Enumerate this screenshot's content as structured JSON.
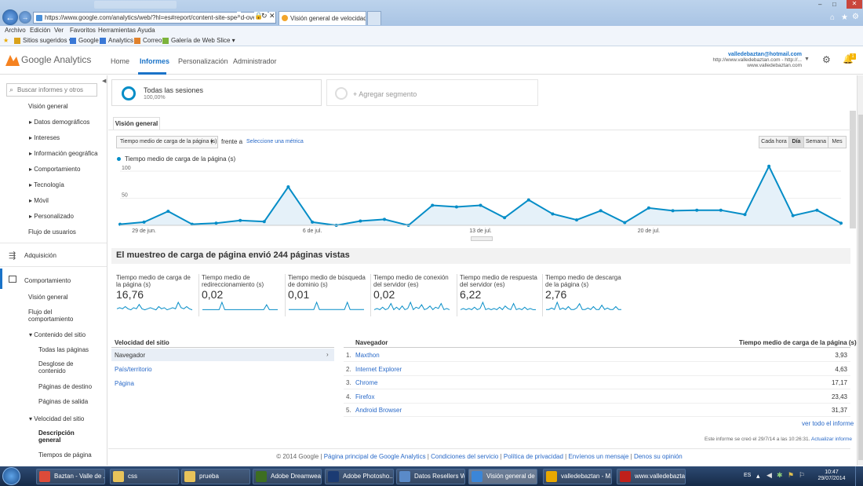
{
  "browser": {
    "url": "https://www.google.com/analytics/web/?hl=es#report/content-site-speed-overvi",
    "tabs": [
      {
        "label": "Visión general de velocidad..."
      }
    ],
    "blurred_tab": "",
    "window_controls": {
      "min": "–",
      "max": "□",
      "close": "✕"
    },
    "menu": [
      "Archivo",
      "Edición",
      "Ver",
      "Favoritos",
      "Herramientas",
      "Ayuda"
    ],
    "favorites": [
      "Sitios sugeridos ▾",
      "Google",
      "Analytics",
      "Correo",
      "Galería de Web Slice ▾"
    ]
  },
  "ga": {
    "logo": "Google Analytics",
    "tabs": [
      "Home",
      "Informes",
      "Personalización",
      "Administrador"
    ],
    "account_email": "valledebaztan@hotmail.com",
    "account_url": "http://www.valledebaztan.com - http://...",
    "account_site": "www.valledebaztan.com",
    "notif_count": "1"
  },
  "sidebar": {
    "search_placeholder": "Buscar informes y otros",
    "items": [
      "Visión general",
      "Datos demográficos",
      "Intereses",
      "Información geográfica",
      "Comportamiento",
      "Tecnología",
      "Móvil",
      "Personalizado",
      "Flujo de usuarios",
      "Adquisición",
      "Comportamiento",
      "Visión general",
      "Flujo del comportamiento",
      "Contenido del sitio",
      "Todas las páginas",
      "Desglose de contenido",
      "Páginas de destino",
      "Páginas de salida",
      "Velocidad del sitio",
      "Descripción general",
      "Tiempos de página"
    ]
  },
  "segments": {
    "active": "Todas las sesiones",
    "active_pct": "100,00%",
    "add": "+ Agregar segmento"
  },
  "report": {
    "tab": "Visión general",
    "metric_select": "Tiempo medio de carga de la página (s)",
    "versus": "frente a",
    "select_metric_link": "Seleccione una métrica",
    "granularity": [
      "Cada hora",
      "Día",
      "Semana",
      "Mes"
    ],
    "summary": "El muestreo de carga de página envió 244 páginas vistas",
    "metrics": [
      {
        "label": "Tiempo medio de carga de la página (s)",
        "value": "16,76"
      },
      {
        "label": "Tiempo medio de redireccionamiento (s)",
        "value": "0,02"
      },
      {
        "label": "Tiempo medio de búsqueda de dominio (s)",
        "value": "0,01"
      },
      {
        "label": "Tiempo medio de conexión del servidor (es)",
        "value": "0,02"
      },
      {
        "label": "Tiempo medio de respuesta del servidor (es)",
        "value": "6,22"
      },
      {
        "label": "Tiempo medio de descarga de la página (s)",
        "value": "2,76"
      }
    ],
    "speed_header": "Velocidad del sitio",
    "speed_dims": [
      "Navegador",
      "País/territorio",
      "Página"
    ],
    "table_headers": [
      "Navegador",
      "Tiempo medio de carga de la página (s)"
    ],
    "table_rows": [
      {
        "idx": "1.",
        "name": "Maxthon",
        "val": "3,93"
      },
      {
        "idx": "2.",
        "name": "Internet Explorer",
        "val": "4,63"
      },
      {
        "idx": "3.",
        "name": "Chrome",
        "val": "17,17"
      },
      {
        "idx": "4.",
        "name": "Firefox",
        "val": "23,43"
      },
      {
        "idx": "5.",
        "name": "Android Browser",
        "val": "31,37"
      }
    ],
    "view_all": "ver todo el informe",
    "created": "Este informe se creó el 29/7/14 a las 10:26:31. -",
    "refresh": "Actualizar informe",
    "footer": [
      "© 2014 Google",
      "Página principal de Google Analytics",
      "Condiciones del servicio",
      "Política de privacidad",
      "Envíenos un mensaje",
      "Denos su opinión"
    ]
  },
  "chart_data": {
    "type": "area",
    "title": "",
    "legend": [
      "Tiempo medio de carga de la página (s)"
    ],
    "xlabel": "",
    "ylabel": "",
    "ylim": [
      0,
      100
    ],
    "yticks": [
      "100",
      "50"
    ],
    "xticks": [
      "29 de jun.",
      "6 de jul.",
      "13 de jul.",
      "20 de jul."
    ],
    "series": [
      {
        "name": "Tiempo medio de carga de la página (s)",
        "values": [
          2,
          6,
          26,
          2,
          4,
          9,
          7,
          71,
          6,
          0,
          8,
          11,
          0,
          37,
          34,
          37,
          14,
          47,
          21,
          10,
          27,
          5,
          32,
          27,
          28,
          28,
          20,
          109,
          18,
          28,
          4
        ]
      }
    ],
    "color": "#058dc7"
  },
  "taskbar": {
    "items": [
      "Baztan - Valle de ...",
      "css",
      "prueba",
      "Adobe Dreamwea...",
      "Adobe Photosho...",
      "Datos Resellers W...",
      "Visión general de ...",
      "valledebaztan - M...",
      "www.valledebazta..."
    ],
    "lang": "ES",
    "time": "10:47",
    "date": "29/07/2014"
  }
}
